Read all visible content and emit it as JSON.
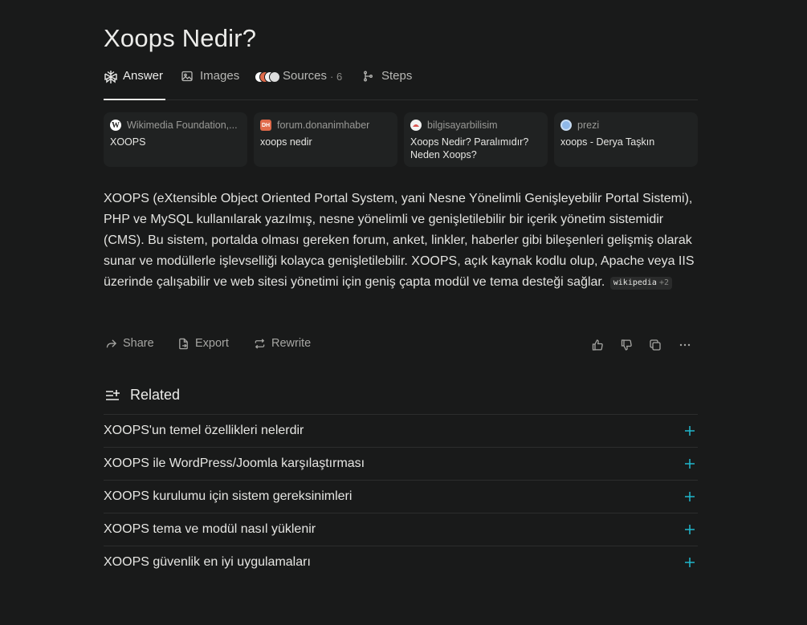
{
  "question": "Xoops Nedir?",
  "tabs": {
    "answer": "Answer",
    "images": "Images",
    "sources": "Sources",
    "sources_count": "· 6",
    "steps": "Steps"
  },
  "sources": [
    {
      "site": "Wikimedia Foundation,...",
      "title": "XOOPS",
      "favicon": "W",
      "favicon_color": "#ffffff"
    },
    {
      "site": "forum.donanimhaber",
      "title": "xoops nedir",
      "favicon": "DH",
      "favicon_color": "#e06a4a"
    },
    {
      "site": "bilgisayarbilisim",
      "title": "Xoops Nedir? Paralımıdır? Neden Xoops?",
      "favicon": "",
      "favicon_color": "#d9534f"
    },
    {
      "site": "prezi",
      "title": "xoops - Derya Taşkın",
      "favicon": "",
      "favicon_color": "#8fb8e8"
    }
  ],
  "answer": {
    "text": "XOOPS (eXtensible Object Oriented Portal System, yani Nesne Yönelimli Genişleyebilir Portal Sistemi), PHP ve MySQL kullanılarak yazılmış, nesne yönelimli ve genişletilebilir bir içerik yönetim sistemidir (CMS). Bu sistem, portalda olması gereken forum, anket, linkler, haberler gibi bileşenleri gelişmiş olarak sunar ve modüllerle işlevselliği kolayca genişletilebilir. XOOPS, açık kaynak kodlu olup, Apache veya IIS üzerinde çalışabilir ve web sitesi yönetimi için geniş çapta modül ve tema desteği sağlar.",
    "citation": "wikipedia",
    "citation_more": "+2"
  },
  "actions": {
    "share": "Share",
    "export": "Export",
    "rewrite": "Rewrite"
  },
  "related": {
    "heading": "Related",
    "items": [
      "XOOPS'un temel özellikleri nelerdir",
      "XOOPS ile WordPress/Joomla karşılaştırması",
      "XOOPS kurulumu için sistem gereksinimleri",
      "XOOPS tema ve modül nasıl yüklenir",
      "XOOPS güvenlik en iyi uygulamaları"
    ]
  },
  "colors": {
    "background": "#191a1a",
    "card": "#202222",
    "accent": "#20b8cd",
    "divider": "#2c2d2d"
  }
}
